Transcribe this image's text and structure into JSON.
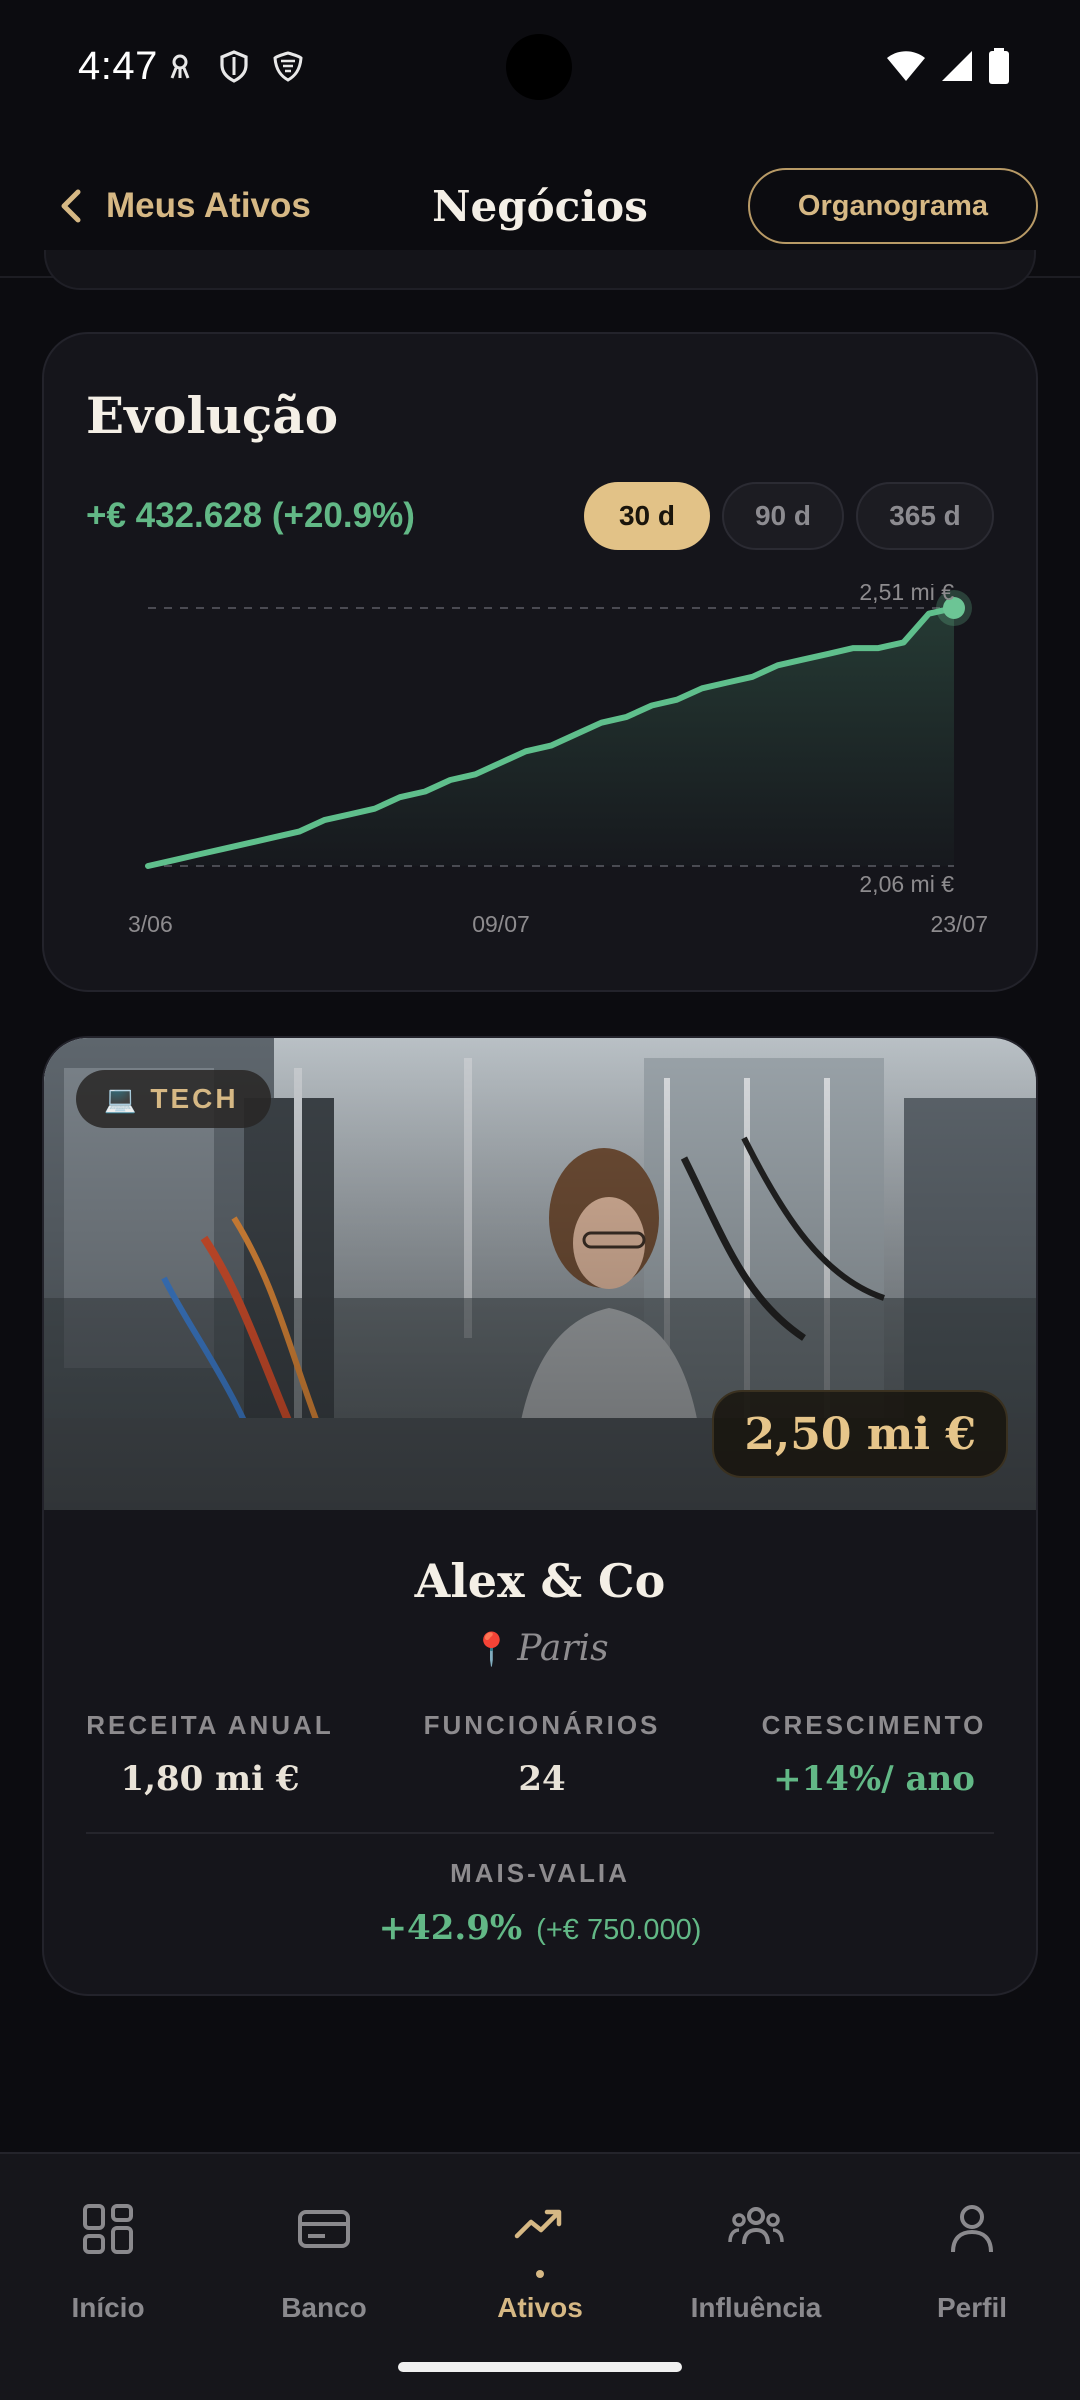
{
  "status_bar": {
    "time": "4:47"
  },
  "header": {
    "back_label": "Meus Ativos",
    "title": "Negócios",
    "org_button": "Organograma"
  },
  "evolution": {
    "title": "Evolução",
    "gain": "+€ 432.628 (+20.9%)",
    "ranges": [
      "30 d",
      "90 d",
      "365 d"
    ],
    "selected_range": "30 d"
  },
  "chart_data": {
    "type": "area",
    "series": [
      {
        "values": [
          2.06,
          2.07,
          2.08,
          2.09,
          2.1,
          2.11,
          2.12,
          2.14,
          2.15,
          2.16,
          2.18,
          2.19,
          2.21,
          2.22,
          2.24,
          2.26,
          2.27,
          2.29,
          2.31,
          2.32,
          2.34,
          2.35,
          2.37,
          2.38,
          2.39,
          2.41,
          2.42,
          2.43,
          2.44,
          2.44,
          2.45,
          2.5,
          2.51
        ]
      }
    ],
    "x_tick_labels": [
      "3/06",
      "09/07",
      "23/07"
    ],
    "ylim": [
      2.06,
      2.51
    ],
    "y_max_label": "2,51 mi €",
    "y_min_label": "2,06 mi €",
    "colors": {
      "line": "#5fbf8c",
      "dot": "#6cc595"
    },
    "grid": "dashed reference lines at min and max"
  },
  "company": {
    "category_icon": "laptop-icon",
    "category_glyph": "💻",
    "category": "TECH",
    "value": "2,50 mi €",
    "name": "Alex & Co",
    "location_glyph": "📍",
    "location": "Paris",
    "stats": [
      {
        "label": "RECEITA ANUAL",
        "value": "1,80 mi €"
      },
      {
        "label": "FUNCIONÁRIOS",
        "value": "24"
      },
      {
        "label": "CRESCIMENTO",
        "value": "+14%/ ano"
      }
    ],
    "capital_gain_label": "MAIS-VALIA",
    "capital_gain_pct": "+42.9%",
    "capital_gain_abs": "(+€ 750.000)"
  },
  "bottom_nav": {
    "items": [
      {
        "label": "Início",
        "icon": "grid-icon"
      },
      {
        "label": "Banco",
        "icon": "card-icon"
      },
      {
        "label": "Ativos",
        "icon": "trending-up-icon"
      },
      {
        "label": "Influência",
        "icon": "people-icon"
      },
      {
        "label": "Perfil",
        "icon": "person-icon"
      }
    ],
    "active": "Ativos"
  },
  "colors": {
    "accent": "#d6b884",
    "positive": "#62b886",
    "background": "#0c0c10",
    "card": "#15151b"
  }
}
